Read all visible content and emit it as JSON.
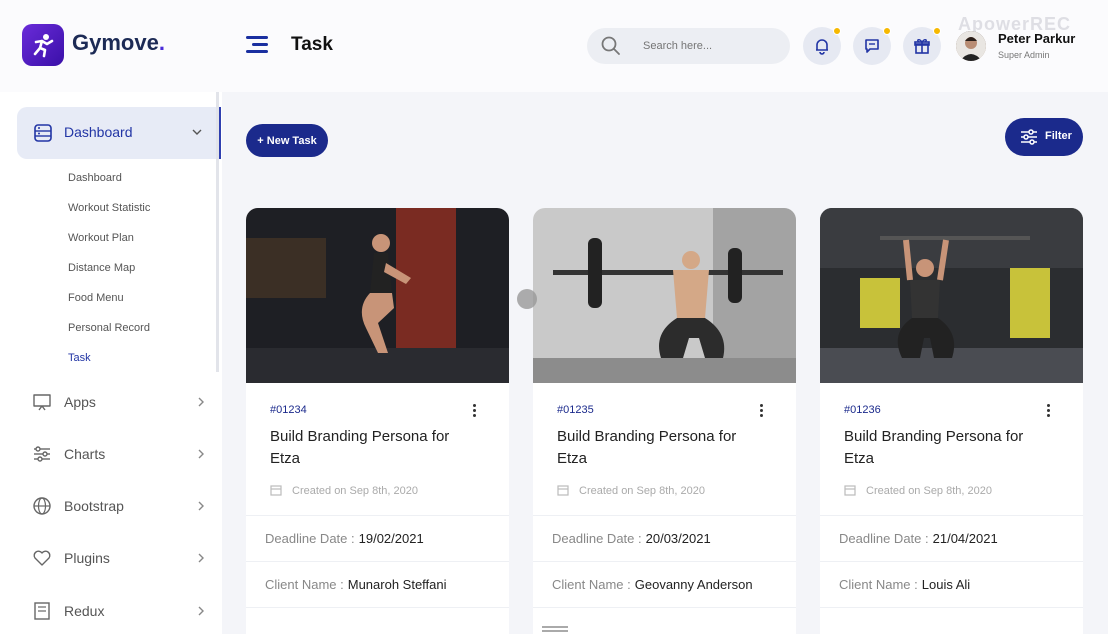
{
  "brand": {
    "name": "Gymove",
    "dot": "."
  },
  "header": {
    "title": "Task",
    "search_placeholder": "Search here...",
    "user_name": "Peter Parkur",
    "user_role": "Super Admin",
    "watermark": "ApowerREC"
  },
  "sidebar": {
    "dashboard_label": "Dashboard",
    "sub_items": [
      "Dashboard",
      "Workout Statistic",
      "Workout Plan",
      "Distance Map",
      "Food Menu",
      "Personal Record",
      "Task"
    ],
    "active_sub": "Task",
    "items": [
      {
        "label": "Apps",
        "icon": "monitor-icon"
      },
      {
        "label": "Charts",
        "icon": "sliders-icon"
      },
      {
        "label": "Bootstrap",
        "icon": "globe-icon"
      },
      {
        "label": "Plugins",
        "icon": "heart-icon"
      },
      {
        "label": "Redux",
        "icon": "document-icon"
      }
    ]
  },
  "toolbar": {
    "new_task_label": "+ New Task",
    "filter_label": "Filter"
  },
  "cards": [
    {
      "id": "#01234",
      "title": "Build Branding Persona for Etza",
      "created": "Created on Sep 8th, 2020",
      "deadline_label": "Deadline Date :",
      "deadline": "19/02/2021",
      "client_label": "Client Name :",
      "client": "Munaroh Steffani"
    },
    {
      "id": "#01235",
      "title": "Build Branding Persona for Etza",
      "created": "Created on Sep 8th, 2020",
      "deadline_label": "Deadline Date :",
      "deadline": "20/03/2021",
      "client_label": "Client Name :",
      "client": "Geovanny Anderson"
    },
    {
      "id": "#01236",
      "title": "Build Branding Persona for Etza",
      "created": "Created on Sep 8th, 2020",
      "deadline_label": "Deadline Date :",
      "deadline": "21/04/2021",
      "client_label": "Client Name :",
      "client": "Louis Ali"
    }
  ],
  "colors": {
    "primary": "#1b2a8c",
    "accent": "#2235a5",
    "notification": "#f6b800"
  }
}
